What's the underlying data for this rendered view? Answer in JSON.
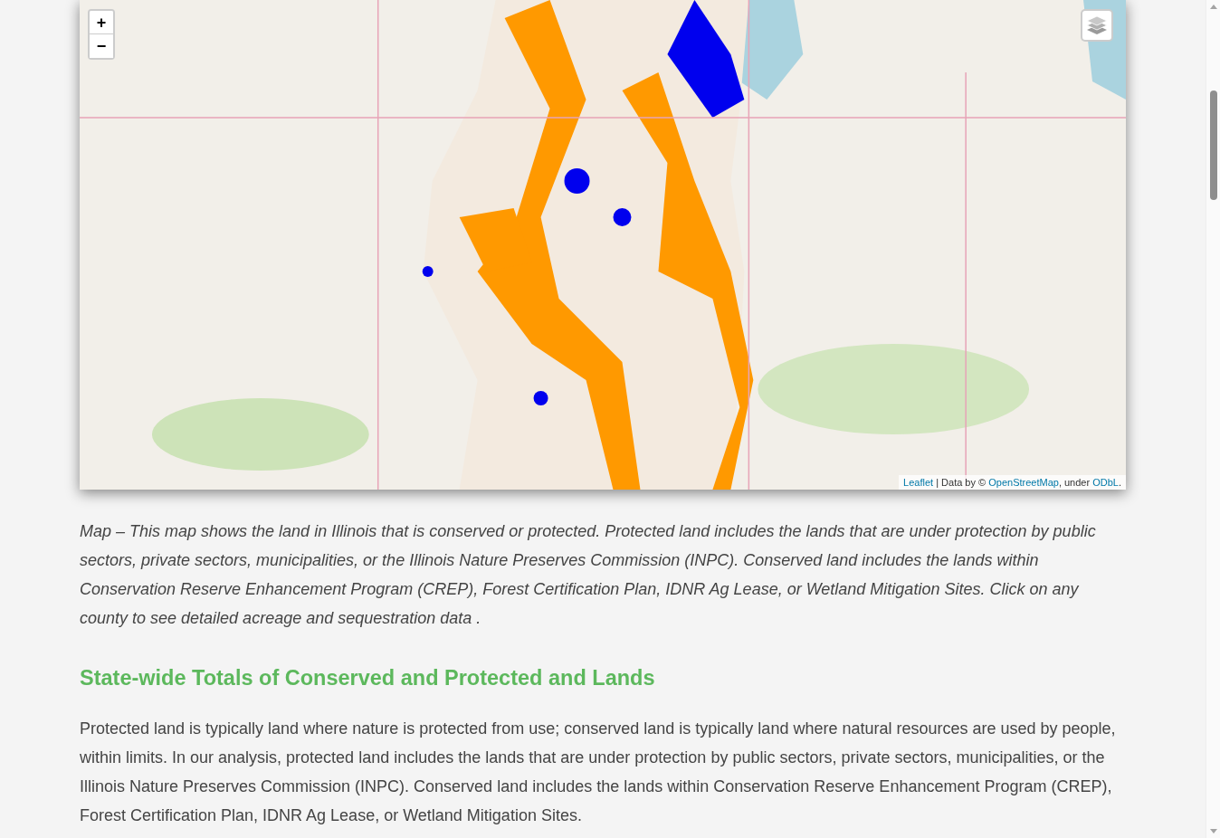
{
  "map": {
    "zoom_in": "+",
    "zoom_out": "−",
    "attribution": [
      {
        "kind": "link",
        "text": "Leaflet"
      },
      {
        "kind": "text",
        "text": " | Data by © "
      },
      {
        "kind": "link",
        "text": "OpenStreetMap"
      },
      {
        "kind": "text",
        "text": ", under "
      },
      {
        "kind": "link",
        "text": "ODbL"
      },
      {
        "kind": "text",
        "text": "."
      }
    ]
  },
  "caption": "Map – This map shows the land in Illinois that is conserved or protected. Protected land includes the lands that are under protection by public sectors, private sectors, municipalities, or the Illinois Nature Preserves Commission (INPC). Conserved land includes the lands within Conservation Reserve Enhancement Program (CREP), Forest Certification Plan, IDNR Ag Lease, or Wetland Mitigation Sites. Click on any county to see detailed acreage and sequestration data .",
  "section": {
    "heading": "State-wide Totals of Conserved and Protected and Lands",
    "paragraph": "Protected land is typically land where nature is protected from use; conserved land is typically land where natural resources are used by people, within limits. In our analysis, protected land includes the lands that are under protection by public sectors, private sectors, municipalities, or the Illinois Nature Preserves Commission (INPC). Conserved land includes the lands within Conservation Reserve Enhancement Program (CREP), Forest Certification Plan, IDNR Ag Lease, or Wetland Mitigation Sites."
  }
}
